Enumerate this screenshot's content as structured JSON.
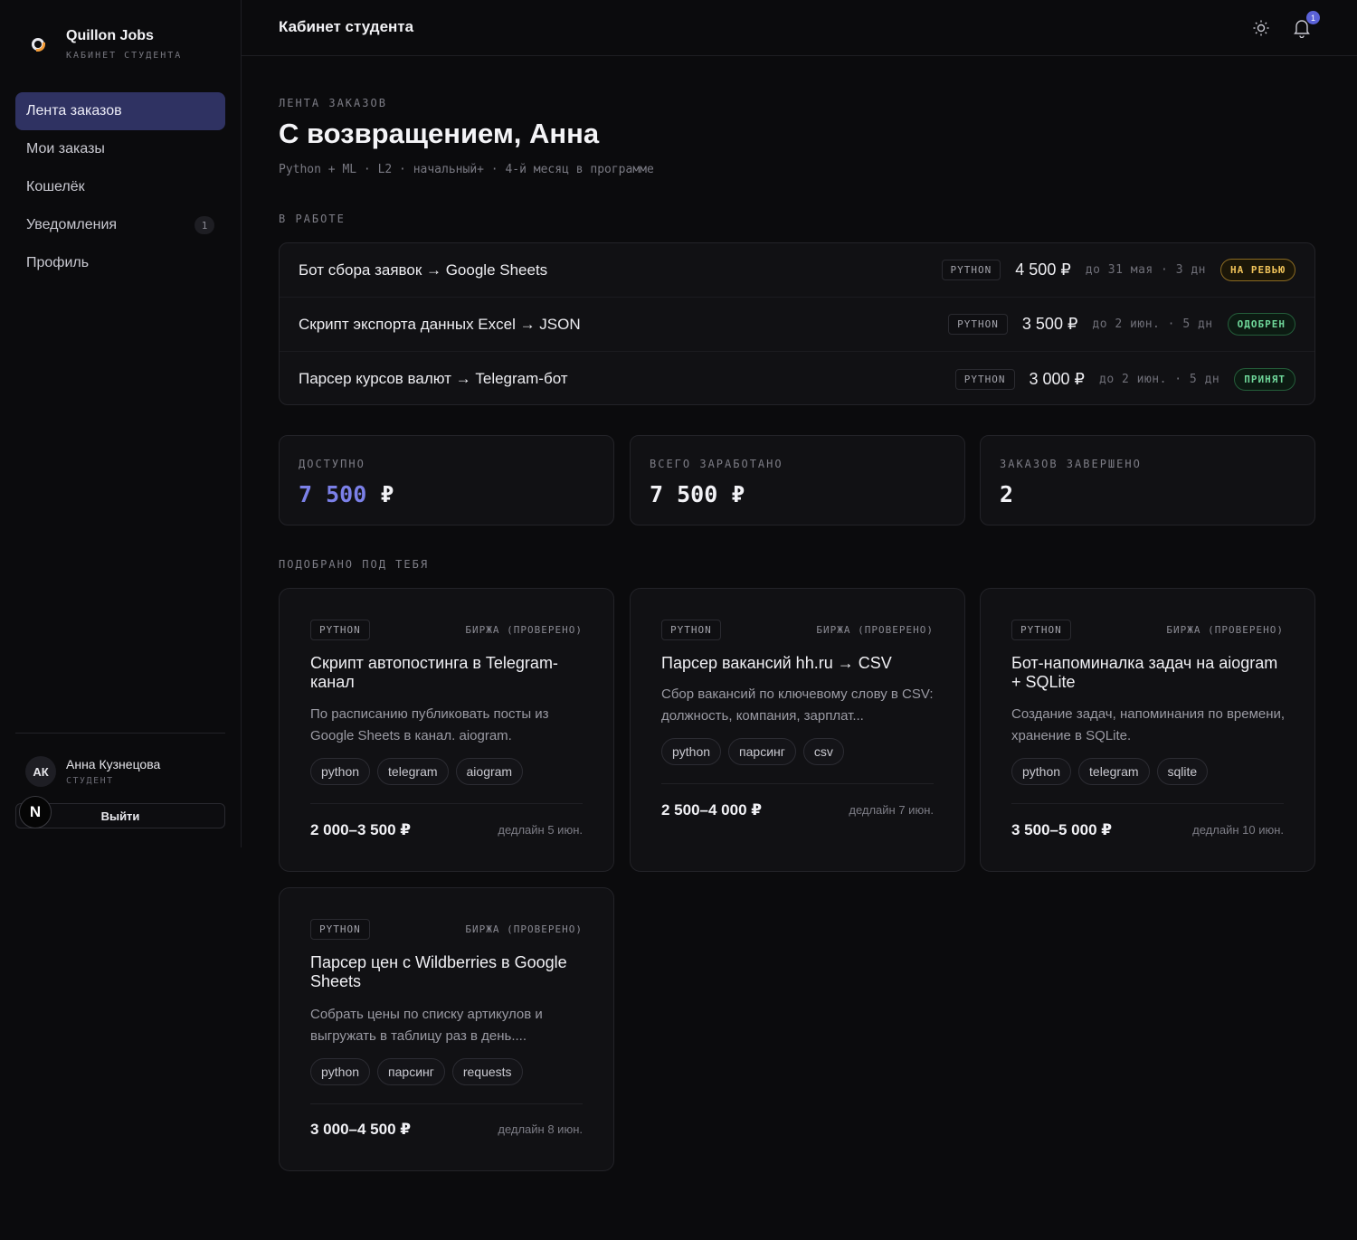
{
  "brand": {
    "title": "Quillon Jobs",
    "subtitle": "КАБИНЕТ СТУДЕНТА"
  },
  "nav": [
    {
      "label": "Лента заказов"
    },
    {
      "label": "Мои заказы"
    },
    {
      "label": "Кошелёк"
    },
    {
      "label": "Уведомления",
      "badge": "1"
    },
    {
      "label": "Профиль"
    }
  ],
  "user": {
    "initials": "АК",
    "name": "Анна Кузнецова",
    "role": "СТУДЕНТ",
    "logout": "Выйти",
    "corner_badge": "N"
  },
  "header": {
    "title": "Кабинет студента",
    "notif_count": "1"
  },
  "page": {
    "eyebrow": "ЛЕНТА ЗАКАЗОВ",
    "title": "С возвращением, Анна",
    "meta": "Python + ML · L2 · начальный+ · 4-й месяц в программе"
  },
  "in_work": {
    "label": "В РАБОТЕ",
    "rows": [
      {
        "title": "Бот сбора заявок → Google Sheets",
        "tag": "PYTHON",
        "price": "4 500 ₽",
        "due": "до 31 мая · 3 дн",
        "status": "НА РЕВЬЮ",
        "status_kind": "review"
      },
      {
        "title": "Скрипт экспорта данных Excel → JSON",
        "tag": "PYTHON",
        "price": "3 500 ₽",
        "due": "до 2 июн. · 5 дн",
        "status": "ОДОБРЕН",
        "status_kind": "approved"
      },
      {
        "title": "Парсер курсов валют → Telegram-бот",
        "tag": "PYTHON",
        "price": "3 000 ₽",
        "due": "до 2 июн. · 5 дн",
        "status": "ПРИНЯТ",
        "status_kind": "accepted"
      }
    ]
  },
  "stats": {
    "available": {
      "label": "ДОСТУПНО",
      "value": "7 500",
      "currency": "₽"
    },
    "earned": {
      "label": "ВСЕГО ЗАРАБОТАНО",
      "value": "7 500 ₽"
    },
    "done": {
      "label": "ЗАКАЗОВ ЗАВЕРШЕНО",
      "value": "2"
    }
  },
  "recommended": {
    "label": "ПОДОБРАНО ПОД ТЕБЯ",
    "jobs": [
      {
        "tag": "PYTHON",
        "source": "БИРЖА (ПРОВЕРЕНО)",
        "title": "Скрипт автопостинга в Telegram-канал",
        "desc": "По расписанию публиковать посты из Google Sheets в канал. aiogram.",
        "chips": [
          "python",
          "telegram",
          "aiogram"
        ],
        "price": "2 000–3 500 ₽",
        "deadline": "дедлайн 5 июн."
      },
      {
        "tag": "PYTHON",
        "source": "БИРЖА (ПРОВЕРЕНО)",
        "title": "Парсер вакансий hh.ru → CSV",
        "desc": "Сбор вакансий по ключевому слову в CSV: должность, компания, зарплат...",
        "chips": [
          "python",
          "парсинг",
          "csv"
        ],
        "price": "2 500–4 000 ₽",
        "deadline": "дедлайн 7 июн."
      },
      {
        "tag": "PYTHON",
        "source": "БИРЖА (ПРОВЕРЕНО)",
        "title": "Бот-напоминалка задач на aiogram + SQLite",
        "desc": "Создание задач, напоминания по времени, хранение в SQLite.",
        "chips": [
          "python",
          "telegram",
          "sqlite"
        ],
        "price": "3 500–5 000 ₽",
        "deadline": "дедлайн 10 июн."
      },
      {
        "tag": "PYTHON",
        "source": "БИРЖА (ПРОВЕРЕНО)",
        "title": "Парсер цен с Wildberries в Google Sheets",
        "desc": "Собрать цены по списку артикулов и выгружать в таблицу раз в день....",
        "chips": [
          "python",
          "парсинг",
          "requests"
        ],
        "price": "3 000–4 500 ₽",
        "deadline": "дедлайн 8 июн."
      }
    ]
  },
  "colors": {
    "accent": "#5b62d8",
    "active_nav": "#2f3262",
    "review": "#f0c35a",
    "approved": "#6fd79a"
  }
}
